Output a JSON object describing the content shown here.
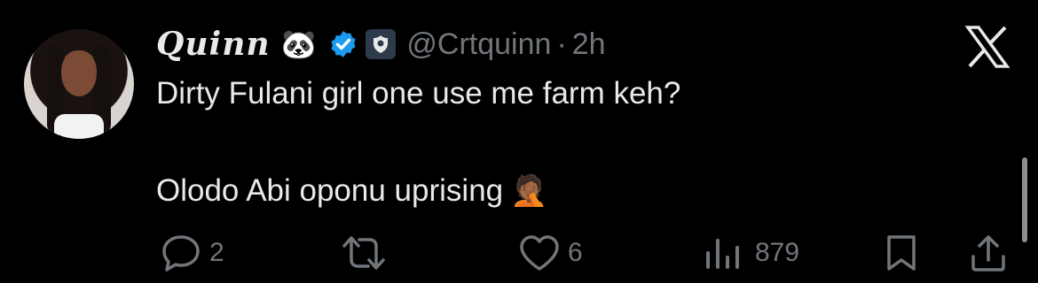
{
  "tweet": {
    "display_name": "Quinn",
    "name_emoji": "🐼",
    "handle": "@Crtquinn",
    "separator": "·",
    "time": "2h",
    "line1": "Dirty Fulani girl one use me farm keh?",
    "line2": "Olodo Abi oponu uprising",
    "line2_emoji": "🤦🏾",
    "verified": true,
    "accent_color": "#1d9bf0"
  },
  "actions": {
    "replies": "2",
    "likes": "6",
    "views": "879"
  },
  "icons": [
    "reply-icon",
    "retweet-icon",
    "like-icon",
    "views-icon",
    "bookmark-icon",
    "share-icon",
    "x-logo-icon",
    "verified-badge-icon"
  ]
}
